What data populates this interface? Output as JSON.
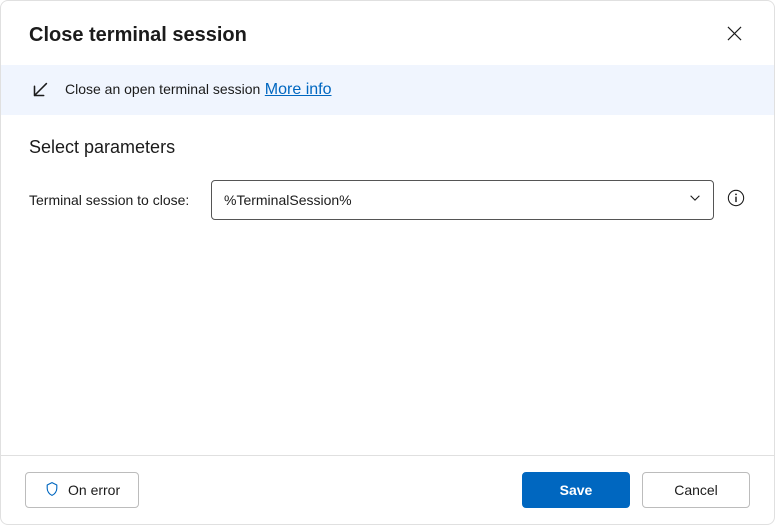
{
  "header": {
    "title": "Close terminal session"
  },
  "info_bar": {
    "description": "Close an open terminal session",
    "link_text": "More info"
  },
  "content": {
    "section_title": "Select parameters",
    "param": {
      "label": "Terminal session to close:",
      "value": "%TerminalSession%"
    }
  },
  "footer": {
    "on_error_label": "On error",
    "save_label": "Save",
    "cancel_label": "Cancel"
  }
}
